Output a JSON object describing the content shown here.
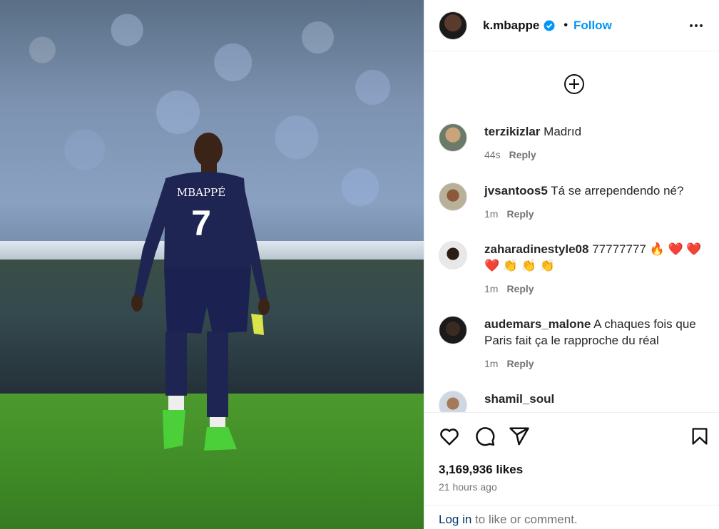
{
  "post": {
    "username": "k.mbappe",
    "follow_label": "Follow",
    "separator": "•",
    "jersey_name": "MBAPPÉ",
    "jersey_number": "7"
  },
  "comments": [
    {
      "user": "terzikizlar",
      "text": "Madrıd",
      "time": "44s",
      "reply": "Reply"
    },
    {
      "user": "jvsantoos5",
      "text": "Tá se arrependendo né?",
      "time": "1m",
      "reply": "Reply"
    },
    {
      "user": "zaharadinestyle08",
      "text": "77777777 🔥 ❤️ ❤️",
      "text2": "❤️ 👏 👏 👏",
      "time": "1m",
      "reply": "Reply"
    },
    {
      "user": "audemars_malone",
      "text": "A chaques fois que",
      "text2": "Paris fait ça le rapproche du réal",
      "time": "1m",
      "reply": "Reply"
    },
    {
      "user": "shamil_soul",
      "text": ""
    }
  ],
  "stats": {
    "likes": "3,169,936 likes",
    "posted": "21 hours ago"
  },
  "footer": {
    "login": "Log in",
    "rest": " to like or comment."
  },
  "colors": {
    "accent": "#0095f6",
    "verified": "#0095f6"
  },
  "icons": [
    "more-icon",
    "add-comment-icon",
    "heart-icon",
    "comment-icon",
    "share-icon",
    "bookmark-icon",
    "verified-icon"
  ]
}
